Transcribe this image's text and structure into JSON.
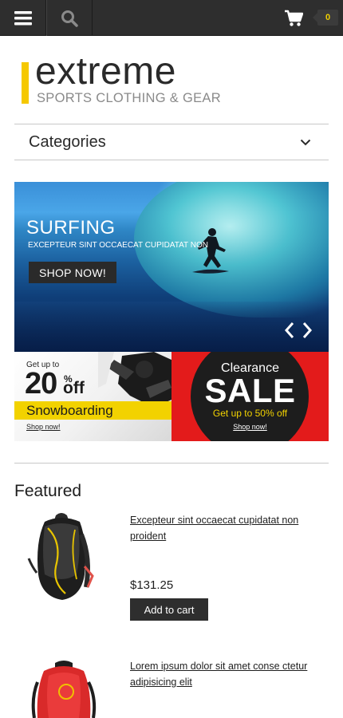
{
  "header": {
    "menu_icon": "hamburger-menu-icon",
    "search_icon": "search-icon",
    "cart_icon": "shopping-cart-icon",
    "cart_count": "0"
  },
  "logo": {
    "title": "extreme",
    "subtitle": "SPORTS CLOTHING & GEAR",
    "accent_color": "#f5c800"
  },
  "categories": {
    "label": "Categories",
    "icon": "chevron-down-icon"
  },
  "hero": {
    "title": "SURFING",
    "text": "EXCEPTEUR SINT OCCAECAT CUPIDATAT NON",
    "button": "SHOP NOW!",
    "prev_icon": "chevron-left-icon",
    "next_icon": "chevron-right-icon"
  },
  "promo_left": {
    "get_up_to": "Get up to",
    "number": "20",
    "percent": "%",
    "off": "off",
    "category": "Snowboarding",
    "shop": "Shop now!",
    "accent_color": "#f2d200"
  },
  "promo_right": {
    "clearance": "Clearance",
    "sale": "SALE",
    "get": "Get up to 50% off",
    "shop": "Shop now!",
    "background_color": "#e31b1b"
  },
  "featured": {
    "title": "Featured",
    "products": [
      {
        "name": "Excepteur sint occaecat cupidatat non proident",
        "price": "$131.25",
        "button": "Add to cart"
      },
      {
        "name": "Lorem ipsum dolor sit amet conse ctetur adipisicing elit"
      }
    ]
  }
}
